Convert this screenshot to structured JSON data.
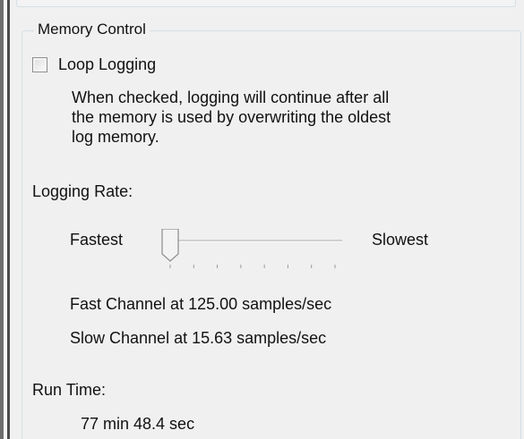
{
  "memory_control": {
    "group_title": "Memory Control",
    "loop_logging": {
      "label": "Loop Logging",
      "checked": false
    },
    "description_lines": [
      "When checked, logging will continue after all",
      "the memory is used by overwriting the oldest",
      "log memory."
    ],
    "logging_rate": {
      "label": "Logging Rate:",
      "min_label": "Fastest",
      "max_label": "Slowest",
      "slider_position": 0,
      "tick_count": 8
    },
    "fast_channel_text": "Fast Channel at 125.00 samples/sec",
    "slow_channel_text": "Slow Channel at 15.63 samples/sec",
    "run_time": {
      "label": "Run Time:",
      "value": "77 min 48.4 sec"
    }
  }
}
